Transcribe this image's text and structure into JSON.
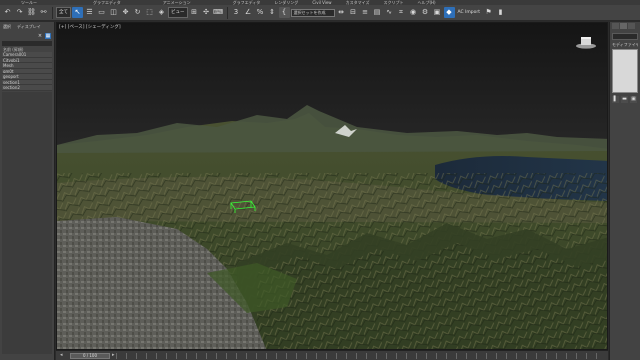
{
  "menubar": {
    "items": [
      "",
      "ツールー",
      "",
      "",
      "",
      "グラフエディタ",
      "",
      "",
      "アニメーション",
      "",
      "",
      "グラフエディタ",
      "レンダリング",
      "Civil View",
      "カスタマイズ",
      "スクリプト",
      "ヘルプ(H)"
    ]
  },
  "toolbar": {
    "selection_filter": "全て",
    "view_select": "ビュー",
    "named_selection_placeholder": "選択セットを作成",
    "render_label": "AC Import"
  },
  "left_panel": {
    "tabs": [
      "選択",
      "ディスプレイ"
    ],
    "column_header": "名前 (昇順)",
    "objects": [
      "Camera001",
      "Cityobj1",
      "Mesh",
      "gm0t",
      "geoport",
      "section1",
      "section2"
    ]
  },
  "viewport": {
    "label": "[+] [ペース] [シェーディング]"
  },
  "right_panel": {
    "label": "モディファイヤ リスト"
  },
  "timeline": {
    "frame_label": "0 / 100"
  },
  "colors": {
    "accent_blue": "#2e6fb8",
    "selection_box": "#39ff39",
    "ui_dark": "#2b2b2b"
  }
}
